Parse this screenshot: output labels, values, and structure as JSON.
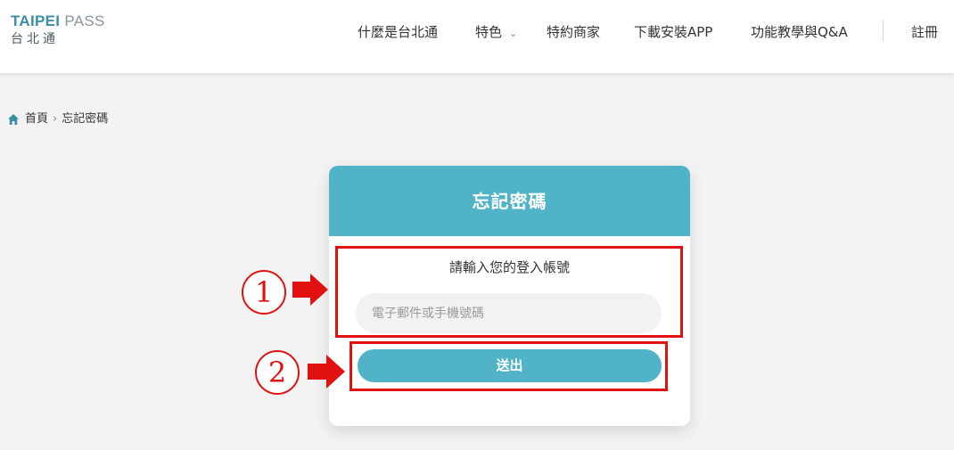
{
  "header": {
    "logo": {
      "bold": "TAIPEI",
      "light": "PASS",
      "sub": "台北通"
    },
    "nav": [
      {
        "label": "什麼是台北通"
      },
      {
        "label": "特色",
        "dropdown": true
      },
      {
        "label": "特約商家"
      },
      {
        "label": "下載安裝APP"
      },
      {
        "label": "功能教學與Q&A"
      }
    ],
    "register_label": "註冊"
  },
  "breadcrumb": {
    "home": "首頁",
    "separator": "›",
    "current": "忘記密碼"
  },
  "card": {
    "title": "忘記密碼",
    "prompt": "請輸入您的登入帳號",
    "email_placeholder": "電子郵件或手機號碼",
    "submit_label": "送出"
  },
  "annotations": {
    "step1": "1",
    "step2": "2"
  },
  "colors": {
    "accent": "#51b3c7",
    "logo": "#3a8fa6",
    "annotation": "#e21111",
    "background": "#f3f3f3"
  },
  "icons": {
    "home": "home-icon",
    "dropdown": "chevron-down-icon",
    "arrow": "arrow-right-icon"
  }
}
